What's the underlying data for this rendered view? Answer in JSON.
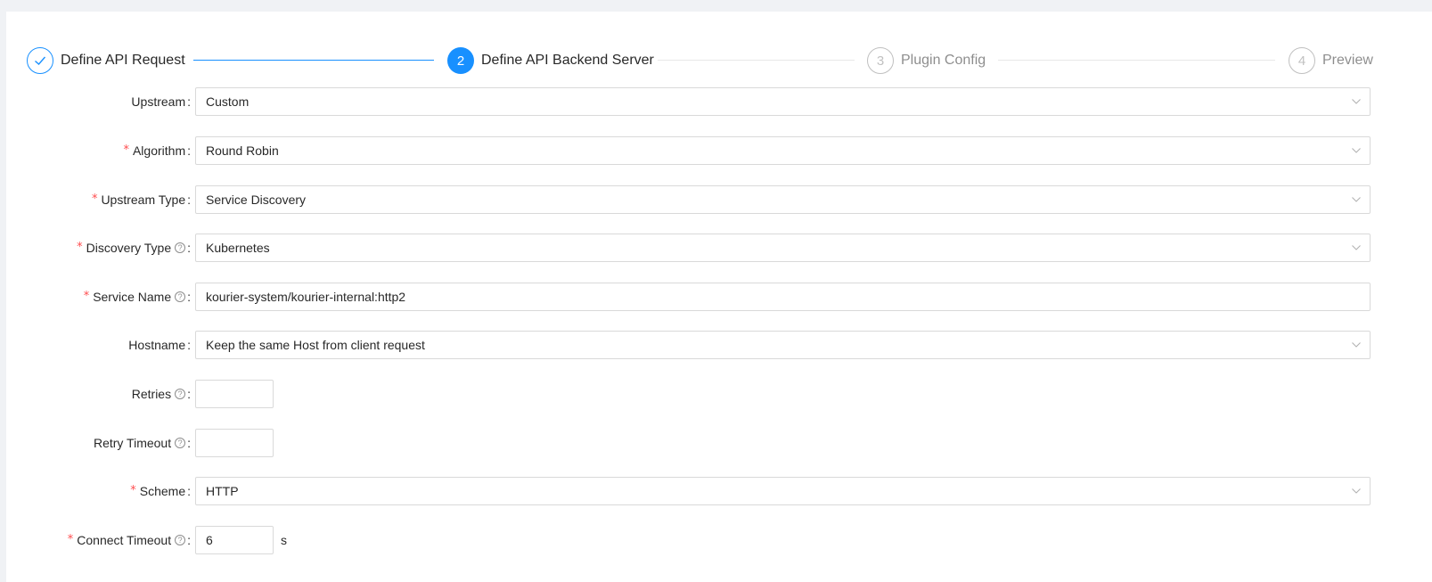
{
  "steps": [
    {
      "number": "",
      "title": "Define API Request",
      "status": "finish"
    },
    {
      "number": "2",
      "title": "Define API Backend Server",
      "status": "process"
    },
    {
      "number": "3",
      "title": "Plugin Config",
      "status": "wait"
    },
    {
      "number": "4",
      "title": "Preview",
      "status": "wait"
    }
  ],
  "form": {
    "upstream": {
      "label": "Upstream",
      "value": "Custom"
    },
    "algorithm": {
      "label": "Algorithm",
      "value": "Round Robin"
    },
    "upstream_type": {
      "label": "Upstream Type",
      "value": "Service Discovery"
    },
    "discovery_type": {
      "label": "Discovery Type",
      "value": "Kubernetes"
    },
    "service_name": {
      "label": "Service Name",
      "value": "kourier-system/kourier-internal:http2"
    },
    "hostname": {
      "label": "Hostname",
      "value": "Keep the same Host from client request"
    },
    "retries": {
      "label": "Retries",
      "value": ""
    },
    "retry_timeout": {
      "label": "Retry Timeout",
      "value": ""
    },
    "scheme": {
      "label": "Scheme",
      "value": "HTTP"
    },
    "connect_timeout": {
      "label": "Connect Timeout",
      "value": "6",
      "suffix": "s"
    }
  },
  "colors": {
    "primary": "#1890ff",
    "required": "#ff4d4f"
  },
  "icons": {
    "finish": "check-icon",
    "select": "chevron-down-icon",
    "help": "question-circle-icon"
  }
}
